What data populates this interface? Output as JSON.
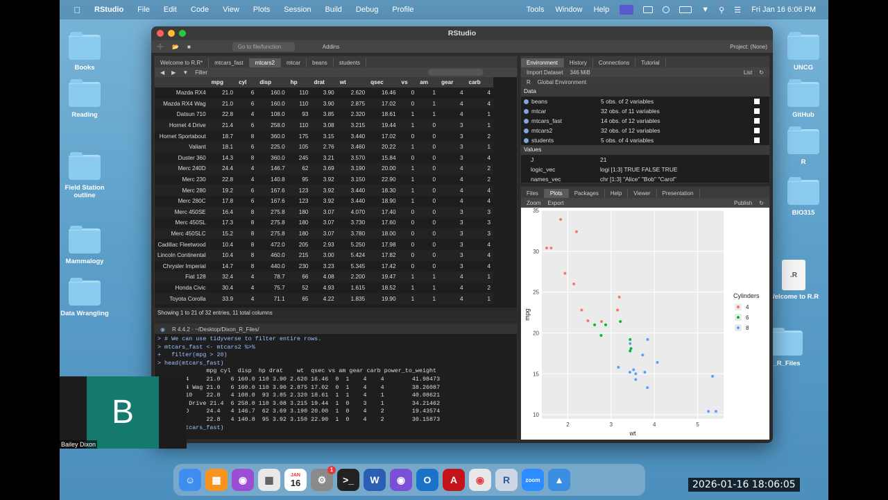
{
  "menubar": {
    "app": "RStudio",
    "items": [
      "File",
      "Edit",
      "Code",
      "View",
      "Plots",
      "Session",
      "Build",
      "Debug",
      "Profile"
    ],
    "right_items": [
      "Tools",
      "Window",
      "Help"
    ],
    "datetime": "Fri Jan 16  6:06 PM"
  },
  "desktop": {
    "left_icons": [
      "Books",
      "Reading",
      "Field Station outline",
      "Mammalogy",
      "Data Wrangling"
    ],
    "right_icons": [
      "UNCG",
      "GitHub",
      "R",
      "BIO315"
    ],
    "file_icon": "Welcome to R.R",
    "partial_label": "_R_Files"
  },
  "window": {
    "title": "RStudio",
    "toolbar": {
      "goto": "Go to file/function",
      "addins": "Addins",
      "project": "Project: (None)"
    }
  },
  "source": {
    "tabs": [
      "Welcome to R.R*",
      "mtcars_fast",
      "mtcars2",
      "mtcar",
      "beans",
      "students"
    ],
    "filter": "Filter",
    "columns": [
      "mpg",
      "cyl",
      "disp",
      "hp",
      "drat",
      "wt",
      "qsec",
      "vs",
      "am",
      "gear",
      "carb"
    ],
    "rows": [
      [
        "Mazda RX4",
        "21.0",
        "6",
        "160.0",
        "110",
        "3.90",
        "2.620",
        "16.46",
        "0",
        "1",
        "4",
        "4"
      ],
      [
        "Mazda RX4 Wag",
        "21.0",
        "6",
        "160.0",
        "110",
        "3.90",
        "2.875",
        "17.02",
        "0",
        "1",
        "4",
        "4"
      ],
      [
        "Datsun 710",
        "22.8",
        "4",
        "108.0",
        "93",
        "3.85",
        "2.320",
        "18.61",
        "1",
        "1",
        "4",
        "1"
      ],
      [
        "Hornet 4 Drive",
        "21.4",
        "6",
        "258.0",
        "110",
        "3.08",
        "3.215",
        "19.44",
        "1",
        "0",
        "3",
        "1"
      ],
      [
        "Hornet Sportabout",
        "18.7",
        "8",
        "360.0",
        "175",
        "3.15",
        "3.440",
        "17.02",
        "0",
        "0",
        "3",
        "2"
      ],
      [
        "Valiant",
        "18.1",
        "6",
        "225.0",
        "105",
        "2.76",
        "3.460",
        "20.22",
        "1",
        "0",
        "3",
        "1"
      ],
      [
        "Duster 360",
        "14.3",
        "8",
        "360.0",
        "245",
        "3.21",
        "3.570",
        "15.84",
        "0",
        "0",
        "3",
        "4"
      ],
      [
        "Merc 240D",
        "24.4",
        "4",
        "146.7",
        "62",
        "3.69",
        "3.190",
        "20.00",
        "1",
        "0",
        "4",
        "2"
      ],
      [
        "Merc 230",
        "22.8",
        "4",
        "140.8",
        "95",
        "3.92",
        "3.150",
        "22.90",
        "1",
        "0",
        "4",
        "2"
      ],
      [
        "Merc 280",
        "19.2",
        "6",
        "167.6",
        "123",
        "3.92",
        "3.440",
        "18.30",
        "1",
        "0",
        "4",
        "4"
      ],
      [
        "Merc 280C",
        "17.8",
        "6",
        "167.6",
        "123",
        "3.92",
        "3.440",
        "18.90",
        "1",
        "0",
        "4",
        "4"
      ],
      [
        "Merc 450SE",
        "16.4",
        "8",
        "275.8",
        "180",
        "3.07",
        "4.070",
        "17.40",
        "0",
        "0",
        "3",
        "3"
      ],
      [
        "Merc 450SL",
        "17.3",
        "8",
        "275.8",
        "180",
        "3.07",
        "3.730",
        "17.60",
        "0",
        "0",
        "3",
        "3"
      ],
      [
        "Merc 450SLC",
        "15.2",
        "8",
        "275.8",
        "180",
        "3.07",
        "3.780",
        "18.00",
        "0",
        "0",
        "3",
        "3"
      ],
      [
        "Cadillac Fleetwood",
        "10.4",
        "8",
        "472.0",
        "205",
        "2.93",
        "5.250",
        "17.98",
        "0",
        "0",
        "3",
        "4"
      ],
      [
        "Lincoln Continental",
        "10.4",
        "8",
        "460.0",
        "215",
        "3.00",
        "5.424",
        "17.82",
        "0",
        "0",
        "3",
        "4"
      ],
      [
        "Chrysler Imperial",
        "14.7",
        "8",
        "440.0",
        "230",
        "3.23",
        "5.345",
        "17.42",
        "0",
        "0",
        "3",
        "4"
      ],
      [
        "Fiat 128",
        "32.4",
        "4",
        "78.7",
        "66",
        "4.08",
        "2.200",
        "19.47",
        "1",
        "1",
        "4",
        "1"
      ],
      [
        "Honda Civic",
        "30.4",
        "4",
        "75.7",
        "52",
        "4.93",
        "1.615",
        "18.52",
        "1",
        "1",
        "4",
        "2"
      ],
      [
        "Toyota Corolla",
        "33.9",
        "4",
        "71.1",
        "65",
        "4.22",
        "1.835",
        "19.90",
        "1",
        "1",
        "4",
        "1"
      ]
    ],
    "footer": "Showing 1 to 21 of 32 entries, 11 total columns"
  },
  "console": {
    "header": "R 4.4.2  ·  ~/Desktop/Dixon_R_Files/",
    "lines": [
      "> # We can use tidyverse to filter entire rows.",
      "> mtcars_fast <- mtcars2 %>%",
      "+   filter(mpg > 20)",
      "> head(mtcars_fast)",
      "              mpg cyl  disp  hp drat    wt  qsec vs am gear carb power_to_weight",
      "Mazda RX4     21.0   6 160.0 110 3.90 2.620 16.46  0  1    4    4        41.98473",
      "Mazda RX4 Wag 21.0   6 160.0 110 3.90 2.875 17.02  0  1    4    4        38.26087",
      "Datsun 710    22.8   4 108.0  93 3.85 2.320 18.61  1  1    4    1        40.08621",
      "Hornet 4 Drive 21.4  6 258.0 110 3.08 3.215 19.44  1  0    3    1        34.21462",
      "Merc 240D     24.4   4 146.7  62 3.69 3.190 20.00  1  0    4    2        19.43574",
      "Merc 230      22.8   4 140.8  95 3.92 3.150 22.90  1  0    4    2        30.15873",
      "> View(mtcars_fast)"
    ]
  },
  "environment": {
    "tabs": [
      "Environment",
      "History",
      "Connections",
      "Tutorial"
    ],
    "import": "Import Dataset",
    "memory": "346 MiB",
    "list": "List",
    "scope": "Global Environment",
    "lang": "R",
    "data_label": "Data",
    "values_label": "Values",
    "data": [
      {
        "name": "beans",
        "value": "5 obs. of 2 variables"
      },
      {
        "name": "mtcar",
        "value": "32 obs. of 11 variables"
      },
      {
        "name": "mtcars_fast",
        "value": "14 obs. of 12 variables"
      },
      {
        "name": "mtcars2",
        "value": "32 obs. of 12 variables"
      },
      {
        "name": "students",
        "value": "5 obs. of 4 variables"
      }
    ],
    "values": [
      {
        "name": "J",
        "value": "21"
      },
      {
        "name": "logic_vec",
        "value": "logi [1:3] TRUE FALSE TRUE"
      },
      {
        "name": "names_vec",
        "value": "chr [1:3] \"Alice\" \"Bob\" \"Carol\""
      }
    ]
  },
  "files": {
    "tabs": [
      "Files",
      "Plots",
      "Packages",
      "Help",
      "Viewer",
      "Presentation"
    ],
    "zoom": "Zoom",
    "export": "Export",
    "publish": "Publish"
  },
  "chart_data": {
    "type": "scatter",
    "xlabel": "wt",
    "ylabel": "mpg",
    "xlim": [
      1.4,
      5.6
    ],
    "ylim": [
      9.5,
      35
    ],
    "xticks": [
      2,
      3,
      4,
      5
    ],
    "yticks": [
      10,
      15,
      20,
      25,
      30,
      35
    ],
    "legend_title": "Cylinders",
    "series": [
      {
        "name": "4",
        "color": "#f8766d",
        "points": [
          [
            1.615,
            30.4
          ],
          [
            1.835,
            33.9
          ],
          [
            2.2,
            32.4
          ],
          [
            1.513,
            30.4
          ],
          [
            2.32,
            22.8
          ],
          [
            2.465,
            21.5
          ],
          [
            3.19,
            24.4
          ],
          [
            3.15,
            22.8
          ],
          [
            2.14,
            26.0
          ],
          [
            1.935,
            27.3
          ],
          [
            2.78,
            21.4
          ]
        ]
      },
      {
        "name": "6",
        "color": "#00ba38",
        "points": [
          [
            2.62,
            21.0
          ],
          [
            2.875,
            21.0
          ],
          [
            3.215,
            21.4
          ],
          [
            3.46,
            18.1
          ],
          [
            3.44,
            19.2
          ],
          [
            3.44,
            17.8
          ],
          [
            2.77,
            19.7
          ]
        ]
      },
      {
        "name": "8",
        "color": "#619cff",
        "points": [
          [
            3.44,
            18.7
          ],
          [
            3.57,
            14.3
          ],
          [
            4.07,
            16.4
          ],
          [
            3.73,
            17.3
          ],
          [
            3.78,
            15.2
          ],
          [
            5.25,
            10.4
          ],
          [
            5.424,
            10.4
          ],
          [
            5.345,
            14.7
          ],
          [
            3.52,
            15.5
          ],
          [
            3.435,
            15.2
          ],
          [
            3.84,
            13.3
          ],
          [
            3.845,
            19.2
          ],
          [
            3.17,
            15.8
          ],
          [
            3.57,
            15.0
          ]
        ]
      }
    ]
  },
  "webcam": {
    "initial": "B",
    "name": "Bailey Dixon"
  },
  "clock": "2026-01-16  18:06:05",
  "dock": [
    "Finder",
    "Books",
    "Podcasts",
    "Launchpad",
    "Calendar",
    "Settings",
    "Terminal",
    "Word",
    "GitHub",
    "Outlook",
    "Acrobat",
    "Chrome",
    "R",
    "Zoom",
    "Keynote"
  ],
  "dock_calendar": {
    "month": "JAN",
    "day": "16"
  },
  "dock_badge": "1"
}
